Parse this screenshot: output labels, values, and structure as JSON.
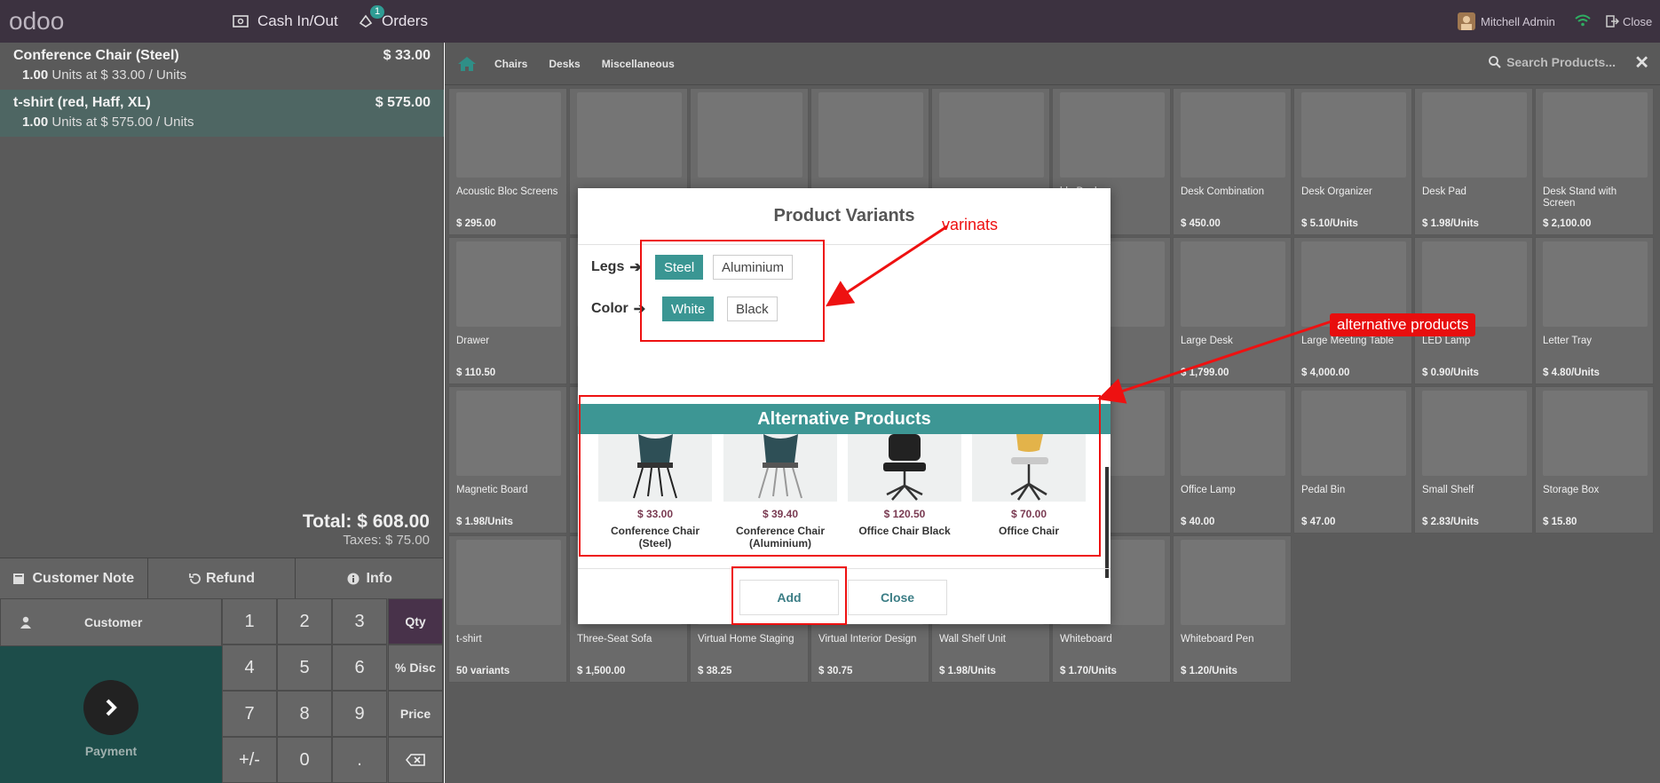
{
  "navbar": {
    "logo": "odoo",
    "cash_label": "Cash In/Out",
    "orders_label": "Orders",
    "orders_badge": "1",
    "user_name": "Mitchell Admin",
    "close_label": "Close"
  },
  "order": {
    "lines": [
      {
        "name": "Conference Chair (Steel)",
        "price": "$ 33.00",
        "qty": "1.00",
        "info": "Units at $ 33.00 / Units"
      },
      {
        "name": "t-shirt (red, Haff, XL)",
        "price": "$ 575.00",
        "qty": "1.00",
        "info": "Units at $ 575.00 / Units"
      }
    ],
    "total": "Total: $ 608.00",
    "taxes": "Taxes: $ 75.00"
  },
  "controls": {
    "customer_note": "Customer Note",
    "refund": "Refund",
    "info": "Info",
    "customer": "Customer",
    "payment": "Payment"
  },
  "numpad": {
    "keys": [
      "1",
      "2",
      "3",
      "Qty",
      "4",
      "5",
      "6",
      "% Disc",
      "7",
      "8",
      "9",
      "Price",
      "+/-",
      "0",
      "."
    ]
  },
  "categories": {
    "items": [
      "Chairs",
      "Desks",
      "Miscellaneous"
    ],
    "search_placeholder": "Search Products..."
  },
  "products": [
    {
      "name": "Acoustic Bloc Screens",
      "price": "$ 295.00"
    },
    {
      "name": "",
      "price": ""
    },
    {
      "name": "",
      "price": ""
    },
    {
      "name": "",
      "price": ""
    },
    {
      "name": "",
      "price": ""
    },
    {
      "name": "ble Desk",
      "price": ""
    },
    {
      "name": "Desk Combination",
      "price": "$ 450.00"
    },
    {
      "name": "Desk Organizer",
      "price": "$ 5.10/Units"
    },
    {
      "name": "Desk Pad",
      "price": "$ 1.98/Units"
    },
    {
      "name": "Desk Stand with Screen",
      "price": "$ 2,100.00"
    },
    {
      "name": "Drawer",
      "price": "$ 110.50"
    },
    {
      "name": "",
      "price": ""
    },
    {
      "name": "",
      "price": ""
    },
    {
      "name": "",
      "price": ""
    },
    {
      "name": "",
      "price": ""
    },
    {
      "name": "net",
      "price": ""
    },
    {
      "name": "Large Desk",
      "price": "$ 1,799.00"
    },
    {
      "name": "Large Meeting Table",
      "price": "$ 4,000.00"
    },
    {
      "name": "LED Lamp",
      "price": "$ 0.90/Units"
    },
    {
      "name": "Letter Tray",
      "price": "$ 4.80/Units"
    },
    {
      "name": "Magnetic Board",
      "price": "$ 1.98/Units"
    },
    {
      "name": "",
      "price": ""
    },
    {
      "name": "",
      "price": ""
    },
    {
      "name": "",
      "price": ""
    },
    {
      "name": "",
      "price": ""
    },
    {
      "name": "gn",
      "price": ""
    },
    {
      "name": "Office Lamp",
      "price": "$ 40.00"
    },
    {
      "name": "Pedal Bin",
      "price": "$ 47.00"
    },
    {
      "name": "Small Shelf",
      "price": "$ 2.83/Units"
    },
    {
      "name": "Storage Box",
      "price": "$ 15.80"
    },
    {
      "name": "t-shirt",
      "price": "50 variants"
    },
    {
      "name": "Three-Seat Sofa",
      "price": "$ 1,500.00"
    },
    {
      "name": "Virtual Home Staging",
      "price": "$ 38.25"
    },
    {
      "name": "Virtual Interior Design",
      "price": "$ 30.75"
    },
    {
      "name": "Wall Shelf Unit",
      "price": "$ 1.98/Units"
    },
    {
      "name": "Whiteboard",
      "price": "$ 1.70/Units"
    },
    {
      "name": "Whiteboard Pen",
      "price": "$ 1.20/Units"
    }
  ],
  "modal": {
    "title": "Product Variants",
    "attributes": [
      {
        "label": "Legs",
        "values": [
          "Steel",
          "Aluminium"
        ],
        "selected": "Steel"
      },
      {
        "label": "Color",
        "values": [
          "White",
          "Black"
        ],
        "selected": "White"
      }
    ],
    "alternative_header": "Alternative Products",
    "alternatives": [
      {
        "price": "$ 33.00",
        "name": "Conference Chair (Steel)"
      },
      {
        "price": "$ 39.40",
        "name": "Conference Chair (Aluminium)"
      },
      {
        "price": "$ 120.50",
        "name": "Office Chair Black"
      },
      {
        "price": "$ 70.00",
        "name": "Office Chair"
      }
    ],
    "add_label": "Add",
    "close_label": "Close"
  },
  "annotations": {
    "variants_label": "varinats",
    "alternatives_label": "alternative products",
    "color": "#e11111"
  }
}
